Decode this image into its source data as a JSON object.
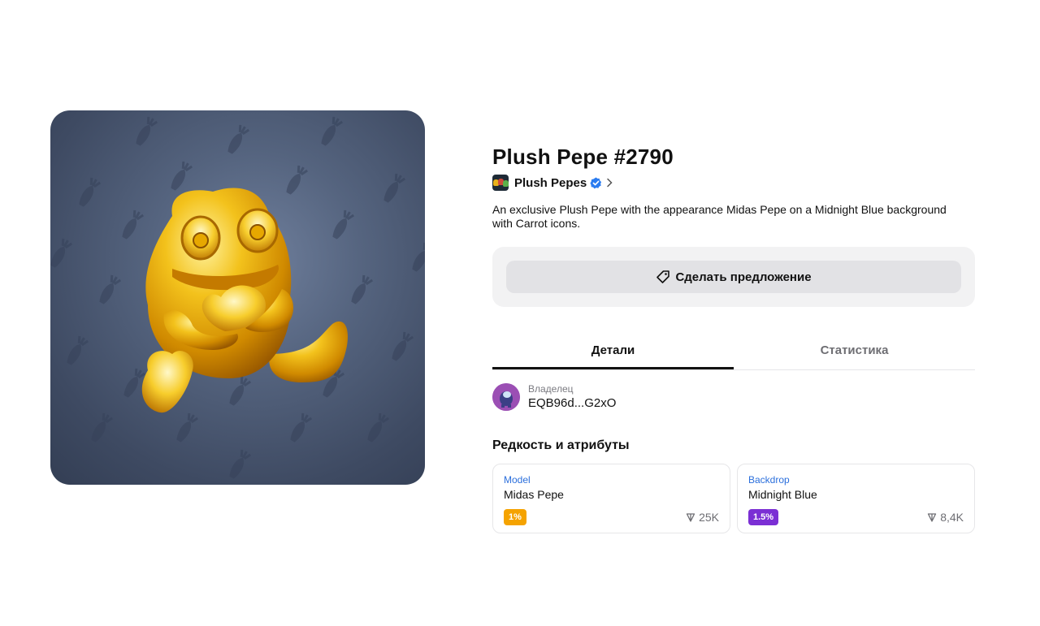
{
  "nft": {
    "title": "Plush Pepe #2790",
    "collection_name": "Plush Pepes",
    "description": "An exclusive Plush Pepe with the appearance Midas Pepe on a Midnight Blue background with Carrot icons.",
    "image_icon": "golden-pepe-artwork"
  },
  "actions": {
    "offer_label": "Сделать предложение",
    "offer_icon": "tag-icon"
  },
  "tabs": [
    {
      "label": "Детали",
      "active": true
    },
    {
      "label": "Статистика",
      "active": false
    }
  ],
  "owner": {
    "label": "Владелец",
    "address": "EQB96d...G2xO"
  },
  "attributes_title": "Редкость и атрибуты",
  "attributes": [
    {
      "type": "Model",
      "value": "Midas Pepe",
      "rarity": "1%",
      "rarity_color": "#f5a300",
      "floor": "25K"
    },
    {
      "type": "Backdrop",
      "value": "Midnight Blue",
      "rarity": "1.5%",
      "rarity_color": "#7b2fd4",
      "floor": "8,4K"
    }
  ],
  "colors": {
    "accent_link": "#2b6fdc",
    "verified": "#2b7cf0",
    "backdrop": "#4a5873"
  }
}
